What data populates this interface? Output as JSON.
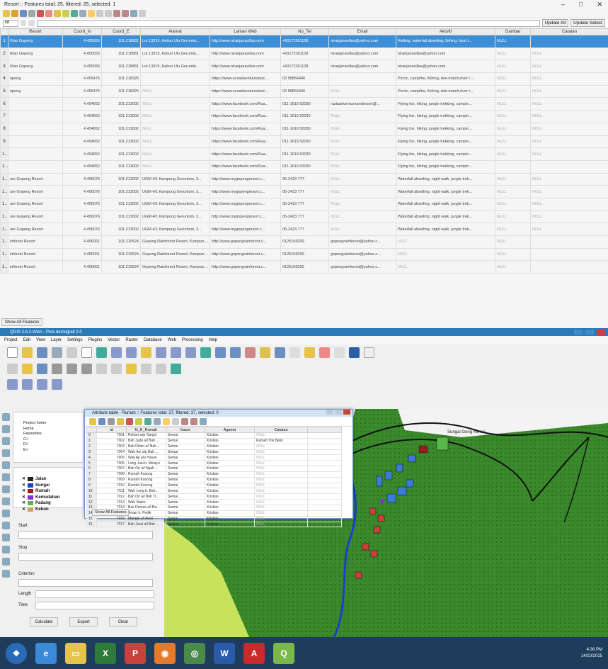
{
  "win1": {
    "title": "Resort :: Features total: 25, filtered: 25, selected: 1",
    "field_select": "lid",
    "buttons": {
      "update_all": "Update All",
      "update_selected": "Update Select"
    },
    "columns": [
      "Resort",
      "Coord_N",
      "Coord_E",
      "Alamat",
      "Laman Web",
      "No_Tel",
      "Email",
      "Aktiviti",
      "Gambar",
      "Catatan"
    ],
    "rows": [
      [
        "1",
        "Riao Gopeng",
        "4.455055",
        "101.218881",
        "Lot 13319, Kebun Ulu Gerumtu...",
        "http://www.niranjanavillas.com",
        "+60172361128",
        "niranjanavillas@yahoo.com",
        "Rafting, waterfall abseiling, fishing, food t...",
        "NULL",
        ""
      ],
      [
        "2",
        "Riao Gopeng",
        "4.455055",
        "101.218881",
        "Lot 13319, Kebun Ulu Gerumtu...",
        "http://www.niranjanavillas.com",
        "+60172361128",
        "niranjanavillas@yahoo.com",
        "niranjanavillas@yahoo.com",
        "NULL",
        "NULL"
      ],
      [
        "3",
        "Riao Gopeng",
        "4.455055",
        "101.218881",
        "Lot 13319, Kebun Ulu Gerumtu...",
        "http://www.niranjanavillas.com",
        "+60172361128",
        "niranjanavillas@yahoo.com",
        "niranjanavillas@yahoo.com",
        "NULL",
        "NULL"
      ],
      [
        "4",
        "openg",
        "4.455475",
        "101.218325",
        "",
        "https://www.ecoadventuresmal...",
        "03 58854440",
        "",
        "Picnic, campfire, fishing, tele-match,river t...",
        "NULL",
        "NULL"
      ],
      [
        "5",
        "openg",
        "4.455475",
        "101.218325",
        "NULL",
        "https://www.ecoadventuresmal...",
        "03 58854440",
        "NULL",
        "Picnic, campfire, fishing, tele-match,river t...",
        "NULL",
        "NULL"
      ],
      [
        "6",
        "",
        "4.454652",
        "101.213002",
        "NULL",
        "https://www.facebook.com/Rua...",
        "011-1619 52030",
        "razlaadventureandresort@...",
        "Flying fox, hiking, jungle trekking, campin...",
        "NULL",
        "NULL"
      ],
      [
        "7",
        "",
        "4.454652",
        "101.213002",
        "NULL",
        "https://www.facebook.com/Rua...",
        "011-1619 52030",
        "NULL",
        "Flying fox, hiking, jungle trekking, campin...",
        "NULL",
        "NULL"
      ],
      [
        "8",
        "",
        "4.454652",
        "101.213002",
        "NULL",
        "https://www.facebook.com/Rua...",
        "011-1619 52030",
        "NULL",
        "Flying fox, hiking, jungle trekking, campin...",
        "NULL",
        "NULL"
      ],
      [
        "9",
        "",
        "4.454652",
        "101.213002",
        "NULL",
        "https://www.facebook.com/Rua...",
        "011-1619 52030",
        "NULL",
        "Flying fox, hiking, jungle trekking, campin...",
        "NULL",
        "NULL"
      ],
      [
        "10",
        "",
        "4.454652",
        "101.213002",
        "NULL",
        "https://www.facebook.com/Rua...",
        "011-1619 52030",
        "NULL",
        "Flying fox, hiking, jungle trekking, campin...",
        "NULL",
        "NULL"
      ],
      [
        "11",
        "",
        "4.454652",
        "101.213002",
        "NULL",
        "https://www.facebook.com/Rua...",
        "011-1619 52030",
        "NULL",
        "Flying fox, hiking, jungle trekking, campin...",
        "",
        ""
      ],
      [
        "12",
        "ure Gopeng Resort",
        "4.456076",
        "101.213002",
        "UGM 4/1 Kampung Geruntom, 3...",
        "http://www.mygopengresort.c...",
        "05-2423 777",
        "NULL",
        "Waterfall abseiling, night walk, jungle trek...",
        "NULL",
        "NULL"
      ],
      [
        "13",
        "ure Gopeng Resort",
        "4.456076",
        "101.213002",
        "UGM 4/1 Kampung Geruntom, 3...",
        "http://www.mygopengresort.c...",
        "05-2423 777",
        "NULL",
        "Waterfall abseiling, night walk, jungle trek...",
        "NULL",
        "NULL"
      ],
      [
        "14",
        "ure Gopeng Resort",
        "4.456076",
        "101.213002",
        "UGM 4/1 Kampung Geruntom, 3...",
        "http://www.mygopengresort.c...",
        "05-2423 777",
        "NULL",
        "Waterfall abseiling, night walk, jungle trek...",
        "NULL",
        "NULL"
      ],
      [
        "15",
        "ure Gopeng Resort",
        "4.456076",
        "101.213002",
        "UGM 4/1 Kampung Geruntom, 3...",
        "http://www.mygopengresort.c...",
        "05-2423 777",
        "NULL",
        "Waterfall abseiling, night walk, jungle trek...",
        "NULL",
        "NULL"
      ],
      [
        "16",
        "ure Gopeng Resort",
        "4.456076",
        "101.213002",
        "UGM 4/1 Kampung Geruntom, 3...",
        "http://www.mygopengresort.c...",
        "05-2423 777",
        "NULL",
        "Waterfall abseiling, night walk, jungle trek...",
        "NULL",
        "NULL"
      ],
      [
        "17",
        "infórest Resort",
        "4.456061",
        "101.210524",
        "Gopeng Rainforest Resort, Kampung Geruntum, 31600 Gop...",
        "http://www.gopengrainforest.c...",
        "0125168200",
        "gopengrainforest@yahoo.c...",
        "NULL",
        "NULL",
        ""
      ],
      [
        "18",
        "infórest Resort",
        "4.456061",
        "101.210524",
        "Gopeng Rainforest Resort, Kampung Geruntum, 31600 Gop...",
        "http://www.gopengrainforest.c...",
        "0125168200",
        "gopengrainforest@yahoo.c...",
        "NULL",
        "NULL",
        ""
      ],
      [
        "19",
        "infórest Resort",
        "4.456061",
        "101.210524",
        "Gopeng Rainforest Resort, Kampung Geruntum, 31600 Gop...",
        "http://www.gopengrainforest.c...",
        "0125168200",
        "gopengrainforest@yahoo.c...",
        "NULL",
        "NULL",
        ""
      ]
    ],
    "show_all": "Show All Features"
  },
  "win2": {
    "title": "QGIS 2.8.2-Wien - Peta demografi 2.0",
    "menu": [
      "Project",
      "Edit",
      "View",
      "Layer",
      "Settings",
      "Plugins",
      "Vector",
      "Raster",
      "Database",
      "Web",
      "Processing",
      "Help"
    ],
    "browser": [
      "Project home",
      "Home",
      "Favourites",
      "C:/",
      "D:/",
      "E:/"
    ],
    "layers": [
      {
        "name": "Jalan",
        "color": "#222222"
      },
      {
        "name": "Sungai",
        "color": "#1a3fd0"
      },
      {
        "name": "Rumah",
        "color": "#9b1c1c"
      },
      {
        "name": "Kemudahan",
        "color": "#8a2be2"
      },
      {
        "name": "Padang",
        "color": "#59b84a"
      },
      {
        "name": "Kebun",
        "color": "#c8a36a"
      }
    ],
    "measure": {
      "start": "Start",
      "stop": "Stop",
      "criterion": "Criterion",
      "length": "Length",
      "time": "Time",
      "calculate": "Calculate",
      "export": "Export",
      "clear": "Clear"
    },
    "map_label": "Sungai Gong Kemai"
  },
  "attr": {
    "title": "Attribute table - Rumah :: Features total: 37, filtered: 37, selected: 0",
    "columns": [
      "id",
      "N_K_Rumah",
      "Kaum",
      "Agama",
      "Catatan"
    ],
    "rows": [
      [
        "0",
        "7001",
        "Rohani a/p Tangoi",
        "Semai",
        "Kristian",
        "NULL"
      ],
      [
        "1",
        "7002",
        "Bah Judu a/l Bah ...",
        "Semai",
        "Kristian",
        "Rumah Tok Batin"
      ],
      [
        "2",
        "7003",
        "Bah Dimin a/l Bah ...",
        "Semai",
        "Kristian",
        "NULL"
      ],
      [
        "3",
        "7004",
        "Wah Ani a/p Bah ...",
        "Semai",
        "Kristian",
        "NULL"
      ],
      [
        "4",
        "7005",
        "Wak Aji a/p Hasan",
        "Semai",
        "Kristian",
        "NULL"
      ],
      [
        "5",
        "7006",
        "Long Juai b. Melayu",
        "Semai",
        "Kristian",
        "NULL"
      ],
      [
        "6",
        "7007",
        "Bah On a/l Ngah ...",
        "Semai",
        "Kristian",
        "NULL"
      ],
      [
        "7",
        "7008",
        "Rumah Kosong",
        "Semai",
        "Kristian",
        "NULL"
      ],
      [
        "8",
        "7009",
        "Rumah Kosong",
        "Semai",
        "Kristian",
        "NULL"
      ],
      [
        "9",
        "7010",
        "Rumah Kosong",
        "Semai",
        "Kristian",
        "NULL"
      ],
      [
        "10",
        "7011",
        "Wah Long b. Bah...",
        "Semai",
        "Kristian",
        "NULL"
      ],
      [
        "11",
        "7012",
        "Bah On a/l Bah Ti...",
        "Semai",
        "Kristian",
        "NULL"
      ],
      [
        "12",
        "7013",
        "Wah Nalen",
        "Semai",
        "Kristian",
        "NULL"
      ],
      [
        "13",
        "7014",
        "Bas Demas a/l Ba...",
        "Semai",
        "Kristian",
        "NULL"
      ],
      [
        "14",
        "7015",
        "Aman b. Pedik",
        "Semai",
        "Kristian",
        "NULL"
      ],
      [
        "15",
        "7016",
        "Mangai a/l Awai",
        "Semai",
        "Kristian",
        "NULL"
      ],
      [
        "16",
        "7017",
        "Bah Jurai a/l Bah ...",
        "Semai",
        "Kristian",
        "NULL"
      ]
    ],
    "show_all": "Show All Features"
  },
  "taskbar": {
    "time": "4:36 PM",
    "date": "14/10/2015"
  }
}
